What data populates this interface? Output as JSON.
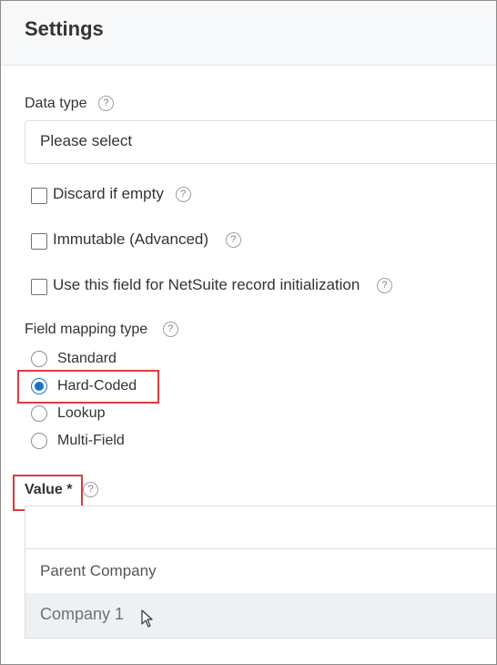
{
  "header": {
    "title": "Settings"
  },
  "data_type": {
    "label": "Data type",
    "placeholder": "Please select"
  },
  "checkboxes": [
    {
      "label": "Discard if empty",
      "checked": false
    },
    {
      "label": "Immutable (Advanced)",
      "checked": false
    },
    {
      "label": "Use this field for NetSuite record initialization",
      "checked": false
    }
  ],
  "field_mapping": {
    "label": "Field mapping type",
    "options": [
      {
        "label": "Standard",
        "selected": false
      },
      {
        "label": "Hard-Coded",
        "selected": true
      },
      {
        "label": "Lookup",
        "selected": false
      },
      {
        "label": "Multi-Field",
        "selected": false
      }
    ]
  },
  "value": {
    "label": "Value *",
    "input_value": "",
    "dropdown": [
      {
        "label": "Parent Company",
        "highlighted": false
      },
      {
        "label": "Company 1",
        "highlighted": true
      }
    ]
  },
  "icons": {
    "help": "?"
  },
  "colors": {
    "accent": "#1a73c8",
    "highlight_border": "#e03a3a",
    "header_bg": "#f7f8f9"
  }
}
